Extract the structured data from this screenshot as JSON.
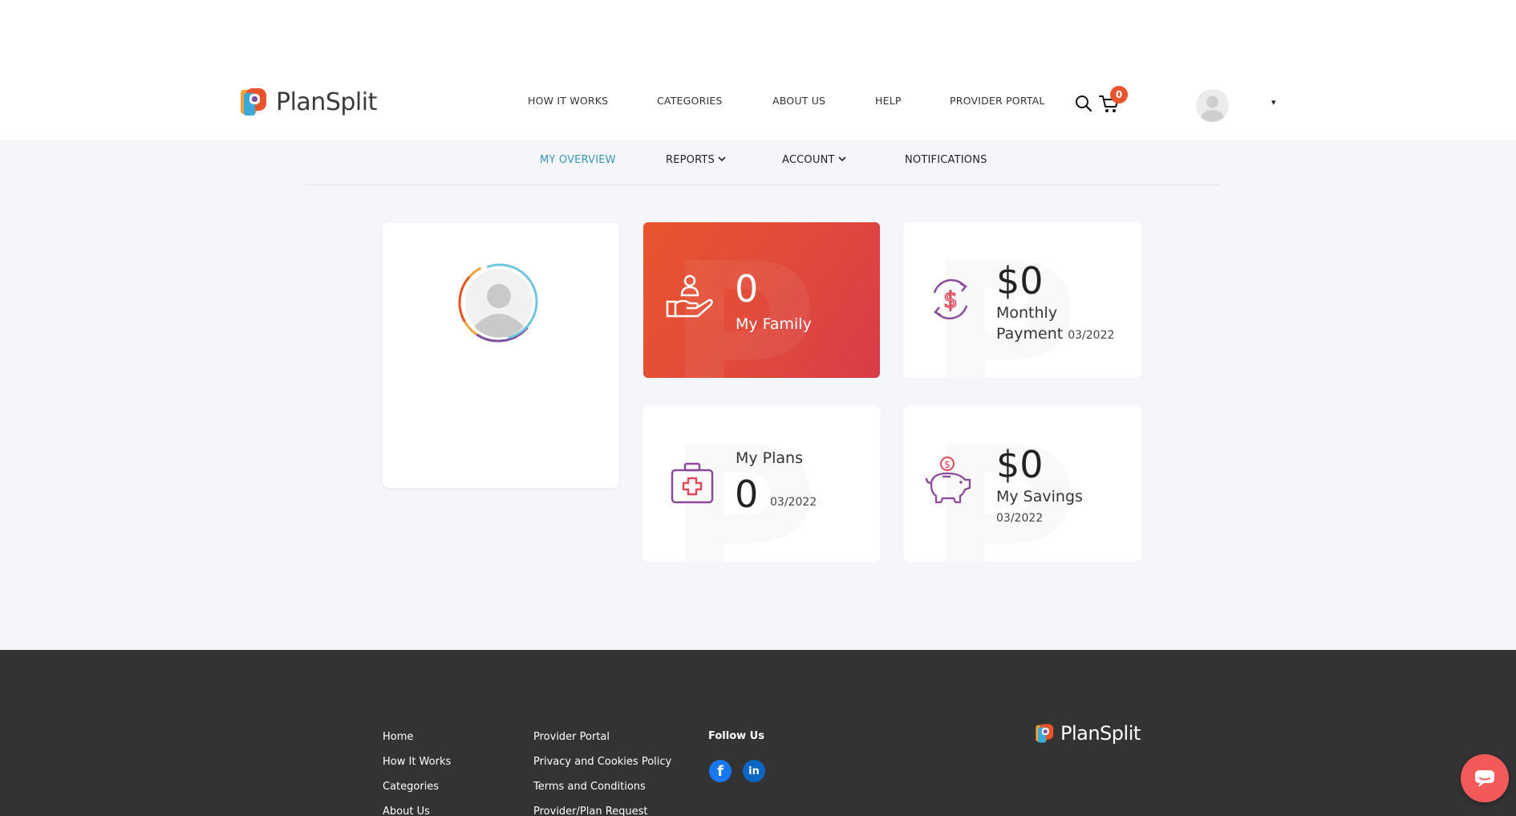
{
  "brand": {
    "name": "PlanSplit"
  },
  "main_nav": [
    {
      "label": "HOW IT WORKS"
    },
    {
      "label": "CATEGORIES"
    },
    {
      "label": "ABOUT US"
    },
    {
      "label": "HELP"
    },
    {
      "label": "PROVIDER PORTAL"
    }
  ],
  "header": {
    "cart_count": "0",
    "search_icon": "search-icon",
    "cart_icon": "cart-icon",
    "user_menu_icon": "chevron-down-icon"
  },
  "sub_nav": [
    {
      "label": "MY OVERVIEW",
      "active": true
    },
    {
      "label": "REPORTS",
      "dropdown": true
    },
    {
      "label": "ACCOUNT",
      "dropdown": true
    },
    {
      "label": "NOTIFICATIONS"
    }
  ],
  "cards": {
    "family": {
      "value": "0",
      "label": "My Family",
      "icon": "family-hand-icon"
    },
    "payment": {
      "value": "$0",
      "label_line1": "Monthly",
      "label_line2": "Payment",
      "date": "03/2022",
      "icon": "dollar-cycle-icon"
    },
    "plans": {
      "title": "My Plans",
      "value": "0",
      "date": "03/2022",
      "icon": "medical-kit-icon"
    },
    "savings": {
      "value": "$0",
      "label": "My Savings",
      "date": "03/2022",
      "icon": "piggy-bank-icon"
    }
  },
  "footer": {
    "col1": [
      "Home",
      "How It Works",
      "Categories",
      "About Us"
    ],
    "col2": [
      "Provider Portal",
      "Privacy and Cookies Policy",
      "Terms and Conditions",
      "Provider/Plan Request"
    ],
    "follow_title": "Follow Us",
    "facebook_glyph": "f",
    "linkedin_glyph": "in"
  },
  "colors": {
    "accent": "#3a93b5",
    "brand_red": "#e8552d",
    "icon_purple": "#8a4c9a",
    "footer_bg": "#333333",
    "chat": "#f25a5a"
  }
}
